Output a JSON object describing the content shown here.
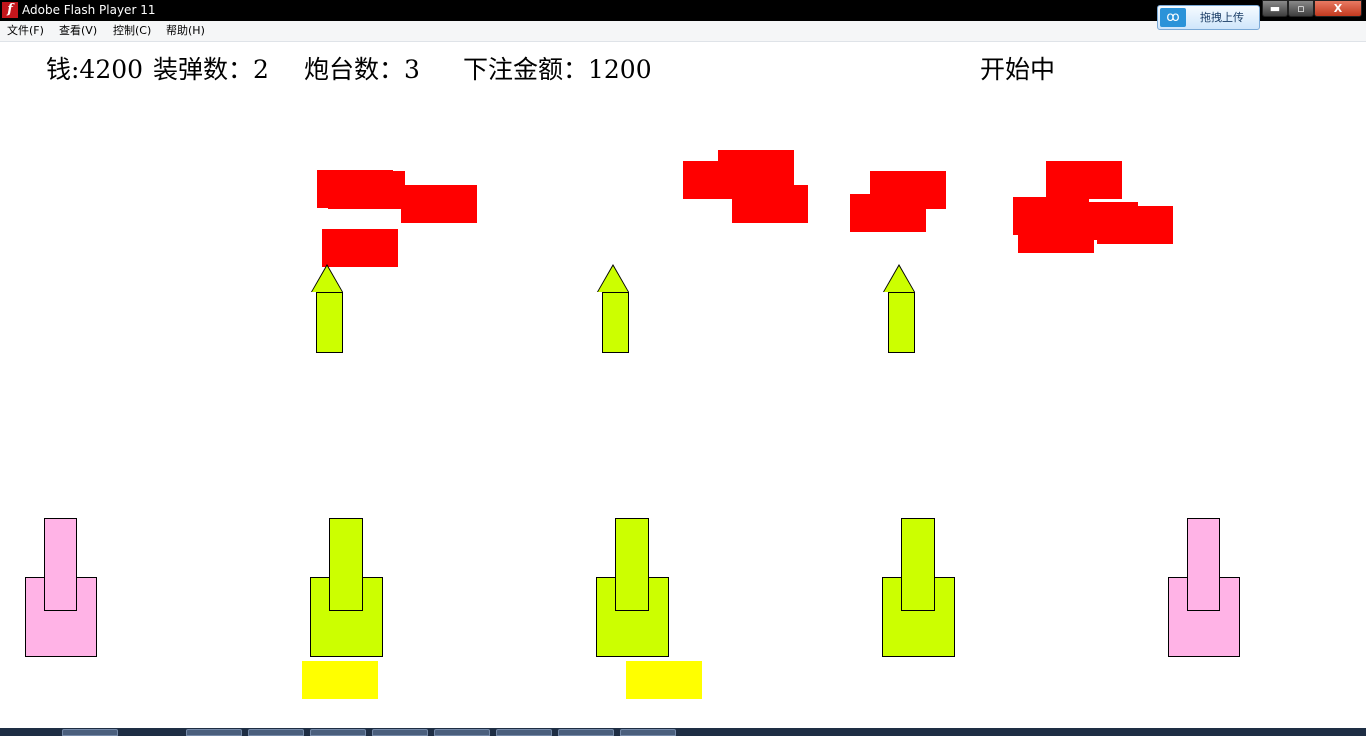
{
  "window": {
    "title": "Adobe Flash Player 11",
    "app_icon": "flash-icon",
    "app_icon_glyph": "f",
    "controls": {
      "minimize_glyph": "▬",
      "maximize_glyph": "▫",
      "close_glyph": "X"
    }
  },
  "upload_widget": {
    "label": "拖拽上传",
    "icon": "cloud-link-icon",
    "glyph": "ꝏ"
  },
  "menu": {
    "items": [
      {
        "label": "文件(F)"
      },
      {
        "label": "查看(V)"
      },
      {
        "label": "控制(C)"
      },
      {
        "label": "帮助(H)"
      }
    ]
  },
  "hud": {
    "money": "钱:4200",
    "ammo": "装弹数：2",
    "turrets": "炮台数：3",
    "bet": "下注金额：1200",
    "status": "开始中"
  },
  "colors": {
    "enemy": "#ff0000",
    "turret_active": "#ccff00",
    "turret_inactive": "#ffb3e6",
    "bullet": "#ccff00",
    "shell_block": "#ffff00",
    "outline": "#000000"
  },
  "game": {
    "turrets": [
      {
        "slot": 1,
        "state": "inactive"
      },
      {
        "slot": 2,
        "state": "active"
      },
      {
        "slot": 3,
        "state": "active"
      },
      {
        "slot": 4,
        "state": "active"
      },
      {
        "slot": 5,
        "state": "inactive"
      }
    ],
    "bullet_count": 3,
    "enemy_count": 12,
    "shell_block_count": 2
  }
}
